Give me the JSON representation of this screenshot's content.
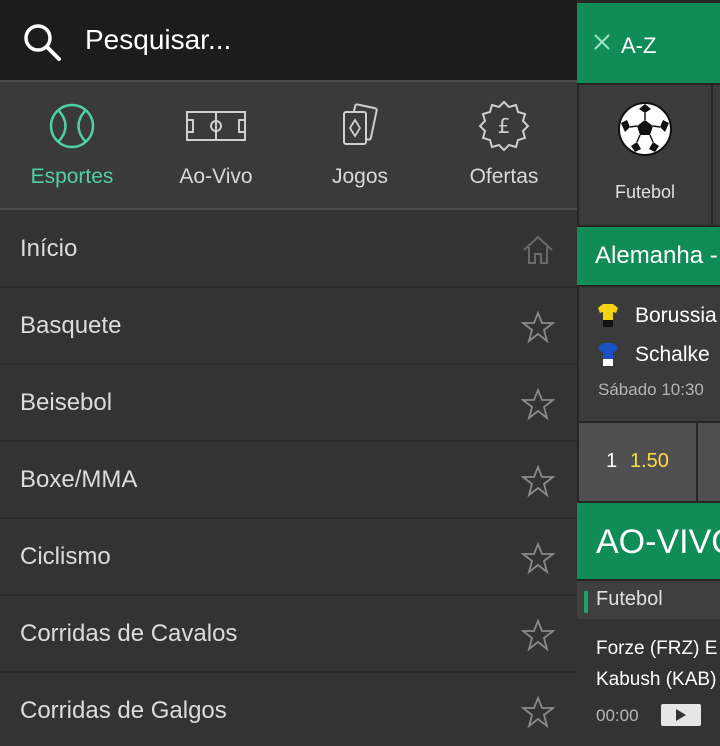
{
  "search": {
    "placeholder": "Pesquisar..."
  },
  "categories": [
    {
      "label": "Esportes",
      "icon": "ball-icon",
      "active": true
    },
    {
      "label": "Ao-Vivo",
      "icon": "field-icon",
      "active": false
    },
    {
      "label": "Jogos",
      "icon": "cards-icon",
      "active": false
    },
    {
      "label": "Ofertas",
      "icon": "pound-badge-icon",
      "active": false
    }
  ],
  "menu_items": [
    {
      "label": "Início",
      "icon": "home-icon"
    },
    {
      "label": "Basquete",
      "icon": "star-icon"
    },
    {
      "label": "Beisebol",
      "icon": "star-icon"
    },
    {
      "label": "Boxe/MMA",
      "icon": "star-icon"
    },
    {
      "label": "Ciclismo",
      "icon": "star-icon"
    },
    {
      "label": "Corridas de Cavalos",
      "icon": "star-icon"
    },
    {
      "label": "Corridas de Galgos",
      "icon": "star-icon"
    }
  ],
  "content": {
    "az_label": "A-Z",
    "sport_tile": {
      "label": "Futebol",
      "icon": "soccer-ball-icon"
    },
    "league": "Alemanha -",
    "match": {
      "home": "Borussia",
      "away": "Schalke",
      "time": "Sábado 10:30",
      "odds_label": "1",
      "odds_value": "1.50"
    },
    "live_title": "AO-VIVO",
    "live_sport": "Futebol",
    "live_match": {
      "team1": "Forze (FRZ) E",
      "team2": "Kabush (KAB)",
      "clock": "00:00"
    }
  },
  "colors": {
    "accent": "#4fd1a1",
    "brand_green": "#108d57",
    "odds_yellow": "#ffd84a"
  }
}
